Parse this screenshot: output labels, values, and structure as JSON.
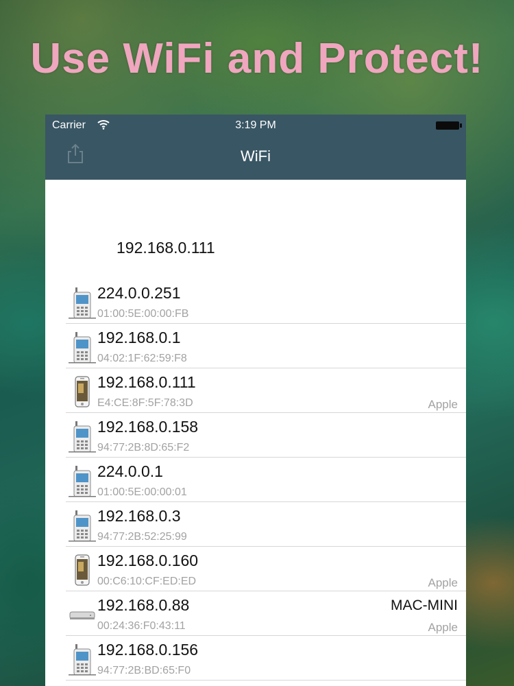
{
  "banner": {
    "headline": "Use WiFi and Protect!"
  },
  "status_bar": {
    "carrier": "Carrier",
    "time": "3:19 PM"
  },
  "nav": {
    "title": "WiFi"
  },
  "own_ip": "192.168.0.111",
  "devices": [
    {
      "ip": "224.0.0.251",
      "mac": "01:00:5E:00:00:FB",
      "vendor": "",
      "host": "",
      "icon": "mobile-phone-icon"
    },
    {
      "ip": "192.168.0.1",
      "mac": "04:02:1F:62:59:F8",
      "vendor": "",
      "host": "",
      "icon": "mobile-phone-icon"
    },
    {
      "ip": "192.168.0.111",
      "mac": "E4:CE:8F:5F:78:3D",
      "vendor": "Apple",
      "host": "",
      "icon": "iphone-icon"
    },
    {
      "ip": "192.168.0.158",
      "mac": "94:77:2B:8D:65:F2",
      "vendor": "",
      "host": "",
      "icon": "mobile-phone-icon"
    },
    {
      "ip": "224.0.0.1",
      "mac": "01:00:5E:00:00:01",
      "vendor": "",
      "host": "",
      "icon": "mobile-phone-icon"
    },
    {
      "ip": "192.168.0.3",
      "mac": "94:77:2B:52:25:99",
      "vendor": "",
      "host": "",
      "icon": "mobile-phone-icon"
    },
    {
      "ip": "192.168.0.160",
      "mac": "00:C6:10:CF:ED:ED",
      "vendor": "Apple",
      "host": "",
      "icon": "iphone-icon"
    },
    {
      "ip": "192.168.0.88",
      "mac": "00:24:36:F0:43:11",
      "vendor": "Apple",
      "host": "MAC-MINI",
      "icon": "mac-mini-icon"
    },
    {
      "ip": "192.168.0.156",
      "mac": "94:77:2B:BD:65:F0",
      "vendor": "",
      "host": "",
      "icon": "mobile-phone-icon"
    }
  ],
  "colors": {
    "nav_bar": "#395664",
    "headline": "#f0a6bf"
  }
}
